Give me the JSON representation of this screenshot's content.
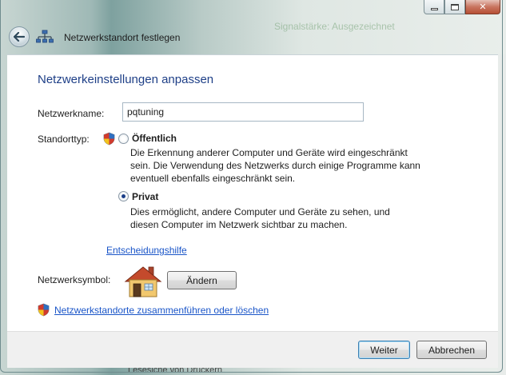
{
  "window": {
    "title": "Netzwerkstandort festlegen",
    "ghost_text": "Signalstärke: Ausgezeichnet",
    "controls": {
      "minimize": "",
      "maximize": "",
      "close": "✕"
    }
  },
  "content": {
    "heading": "Netzwerkeinstellungen anpassen",
    "name_label": "Netzwerkname:",
    "name_value": "pqtuning",
    "location_label": "Standorttyp:",
    "options": [
      {
        "title": "Öffentlich",
        "checked": false,
        "desc_lines": [
          "Die Erkennung anderer Computer und Geräte wird eingeschränkt",
          "sein. Die Verwendung des Netzwerks durch einige Programme kann",
          "eventuell ebenfalls eingeschränkt sein."
        ]
      },
      {
        "title": "Privat",
        "checked": true,
        "desc_lines": [
          "Dies ermöglicht, andere Computer und Geräte zu sehen, und",
          "diesen Computer im Netzwerk sichtbar zu machen."
        ]
      }
    ],
    "help_link": "Entscheidungshilfe",
    "symbol_label": "Netzwerksymbol:",
    "change_button": "Ändern",
    "merge_link": "Netzwerkstandorte zusammenführen oder löschen"
  },
  "footer": {
    "next_button": "Weiter",
    "cancel_button": "Abbrechen"
  },
  "background": {
    "bottom_text": "Lesesiche von Druckern"
  },
  "colors": {
    "heading": "#1e3f87",
    "link": "#1a55c8",
    "content_bg": "#ffffff",
    "footer_bg": "#f0f0f0"
  }
}
